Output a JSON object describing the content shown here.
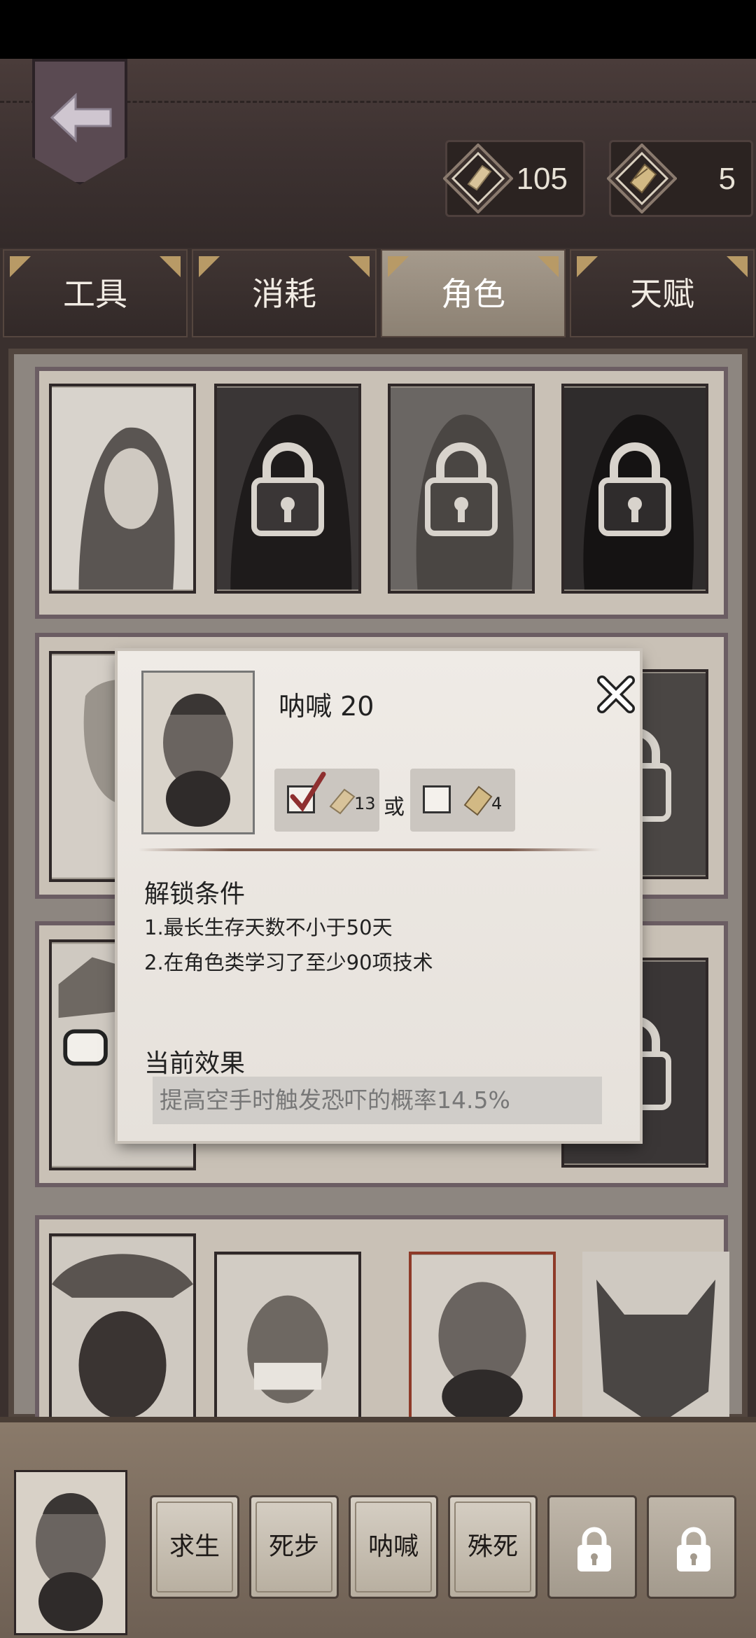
{
  "header": {
    "currencies": [
      {
        "name": "common-scroll",
        "value": "105"
      },
      {
        "name": "rare-scroll",
        "value": "5"
      }
    ]
  },
  "tabs": [
    {
      "label": "工具",
      "active": false
    },
    {
      "label": "消耗",
      "active": false
    },
    {
      "label": "角色",
      "active": true
    },
    {
      "label": "天赋",
      "active": false
    }
  ],
  "modal": {
    "title": "呐喊 20",
    "option_a_count": "13",
    "option_b_count": "4",
    "or_label": "或",
    "unlock_title": "解锁条件",
    "conditions": [
      "1.最长生存天数不小于50天",
      "2.在角色类学习了至少90项技术"
    ],
    "effect_title": "当前效果",
    "effect_text": "提高空手时触发恐吓的概率14.5%"
  },
  "skills": [
    {
      "label": "求生",
      "locked": false
    },
    {
      "label": "死步",
      "locked": false
    },
    {
      "label": "呐喊",
      "locked": false
    },
    {
      "label": "殊死",
      "locked": false
    },
    {
      "label": "",
      "locked": true
    },
    {
      "label": "",
      "locked": true
    }
  ],
  "colors": {
    "leather": "#3d3231",
    "tab_active": "#a59a8c",
    "parchment": "#c9c1b6",
    "selected_border": "#8e3a28"
  }
}
